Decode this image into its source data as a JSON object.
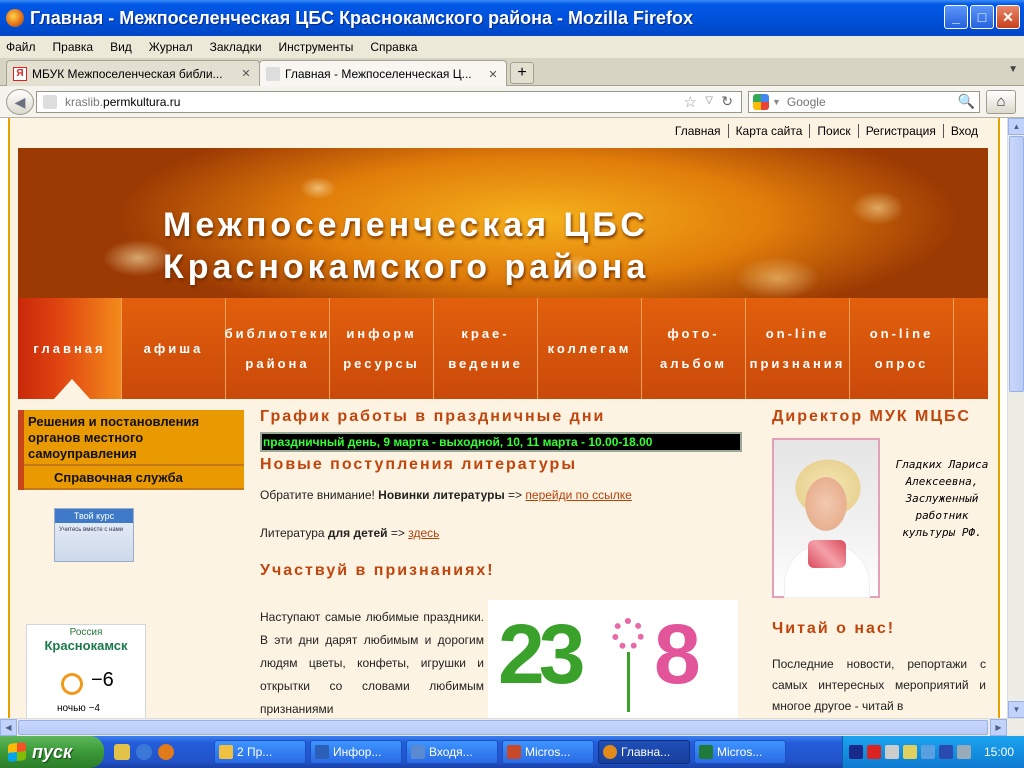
{
  "window": {
    "title": "Главная - Межпоселенческая ЦБС Краснокамского района - Mozilla Firefox",
    "minimize": "_",
    "maximize": "□",
    "close": "✕"
  },
  "menu": [
    "Файл",
    "Правка",
    "Вид",
    "Журнал",
    "Закладки",
    "Инструменты",
    "Справка"
  ],
  "tabs": [
    {
      "label": "МБУК Межпоселенческая библи...",
      "favicon": "Я",
      "close": "✕"
    },
    {
      "label": "Главная - Межпоселенческая Ц...",
      "close": "✕"
    }
  ],
  "newtab": "+",
  "navbar": {
    "url_prefix": "kraslib.",
    "url_domain": "permkultura.ru",
    "search_placeholder": "Google"
  },
  "page": {
    "toplinks": [
      "Главная",
      "Карта сайта",
      "Поиск",
      "Регистрация",
      "Вход"
    ],
    "banner_line1": "Межпоселенческая ЦБС",
    "banner_line2": "Краснокамского района",
    "nav": [
      {
        "l1": "главная",
        "l2": ""
      },
      {
        "l1": "афиша",
        "l2": ""
      },
      {
        "l1": "библиотеки",
        "l2": "района"
      },
      {
        "l1": "информ",
        "l2": "ресурсы"
      },
      {
        "l1": "крае-",
        "l2": "ведение"
      },
      {
        "l1": "коллегам",
        "l2": ""
      },
      {
        "l1": "фото-",
        "l2": "альбом"
      },
      {
        "l1": "on-line",
        "l2": "признания"
      },
      {
        "l1": "on-line",
        "l2": "опрос"
      }
    ],
    "left_menu": [
      "Решения и постановления органов местного самоуправления",
      "Справочная служба"
    ],
    "kurs_banner": {
      "title": "Твой курс",
      "sub": "Учитесь вместе с нами"
    },
    "weather": {
      "country": "Россия",
      "city": "Краснокамск",
      "temp": "−6",
      "night": "ночью −4"
    },
    "schedule_title": "График работы в праздничные дни",
    "schedule_ticker": "праздничный день, 9 марта - выходной, 10, 11 марта - 10.00-18.00",
    "new_lit_title": "Новые поступления литературы",
    "new_lit_p1_a": "Обратите внимание! ",
    "new_lit_p1_b": "Новинки литературы",
    "new_lit_p1_c": " => ",
    "new_lit_p1_link": "перейди по ссылке",
    "new_lit_p2_a": "Литература ",
    "new_lit_p2_b": "для детей",
    "new_lit_p2_c": " => ",
    "new_lit_p2_link": "здесь",
    "participate_title": "Участвуй в признаниях!",
    "participate_text": "Наступают самые любимые праздники. В эти дни дарят любимым и дорогим людям цветы, конфеты, игрушки и открытки со словами любимым признаниями",
    "poster_left": "23",
    "poster_right": "8",
    "director_title": "Директор МУК МЦБС",
    "director_text": "Гладких Лариса Алексеевна, Заслуженный работник культуры РФ.",
    "read_title": "Читай о нас!",
    "read_text": "Последние новости, репортажи с самых интересных мероприятий и многое другое - читай в"
  },
  "taskbar": {
    "start": "пуск",
    "buttons": [
      {
        "label": "2 Пр...",
        "color": "#f0c040"
      },
      {
        "label": "Инфор...",
        "color": "#2b5fb8"
      },
      {
        "label": "Входя...",
        "color": "#5a8ad0"
      },
      {
        "label": "Micros...",
        "color": "#c84a2a"
      },
      {
        "label": "Главна...",
        "color": "#e28a1a"
      },
      {
        "label": "Micros...",
        "color": "#1f7a3a"
      }
    ],
    "clock": "15:00"
  }
}
